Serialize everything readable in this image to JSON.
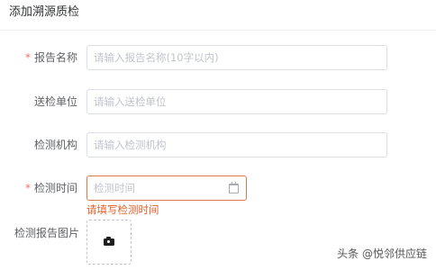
{
  "header": {
    "title": "添加溯源质检"
  },
  "form": {
    "required_mark": "*",
    "report_name": {
      "label": "报告名称",
      "placeholder": "请输入报告名称(10字以内)"
    },
    "inspection_unit": {
      "label": "送检单位",
      "placeholder": "请输入送检单位"
    },
    "inspection_org": {
      "label": "检测机构",
      "placeholder": "请输入检测机构"
    },
    "inspection_time": {
      "label": "检测时间",
      "placeholder": "检测时间",
      "error": "请填写检测时间"
    },
    "report_image": {
      "label": "检测报告图片"
    }
  },
  "colors": {
    "required": "#f56c6c",
    "error": "#e0602b",
    "error_border": "#e0794a",
    "placeholder": "#c0c4cc",
    "border": "#dcdfe6"
  },
  "icons": {
    "calendar": "calendar-icon",
    "camera": "camera-icon"
  },
  "watermark": {
    "text": "头条 @悦邻供应链"
  }
}
